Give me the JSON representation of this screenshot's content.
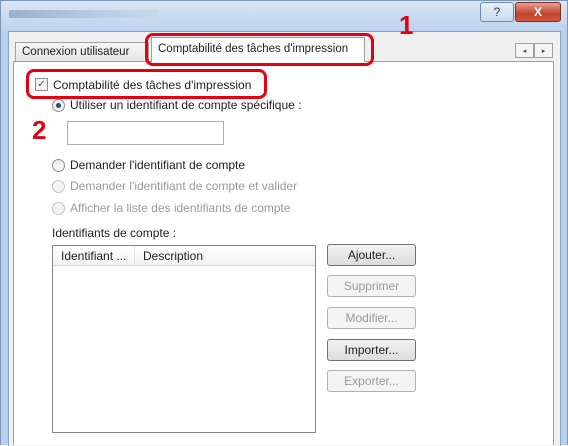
{
  "window": {
    "help_label": "?",
    "close_label": "X"
  },
  "tabs": {
    "tab1_label": "Connexion utilisateur",
    "tab2_label": "Comptabilité des tâches d'impression",
    "scroll_left": "◂",
    "scroll_right": "▸"
  },
  "options": {
    "accounting_checkbox_label": "Comptabilité des tâches d'impression",
    "accounting_checked": true,
    "radio_specific_label": "Utiliser un identifiant de compte spécifique :",
    "specific_id_value": "",
    "radio_ask_label": "Demander l'identifiant de compte",
    "radio_ask_validate_label": "Demander l'identifiant de compte et valider",
    "radio_show_list_label": "Afficher la liste des identifiants de compte"
  },
  "account_list": {
    "section_label": "Identifiants de compte :",
    "columns": [
      "Identifiant ...",
      "Description"
    ],
    "rows": []
  },
  "buttons": {
    "add": "Ajouter...",
    "delete": "Supprimer",
    "modify": "Modifier...",
    "import": "Importer...",
    "export": "Exporter..."
  },
  "callouts": {
    "step1": "1",
    "step2": "2"
  },
  "colors": {
    "highlight": "#e3000f",
    "title_bar": "#bcd2ec",
    "close_button": "#c0432c"
  }
}
